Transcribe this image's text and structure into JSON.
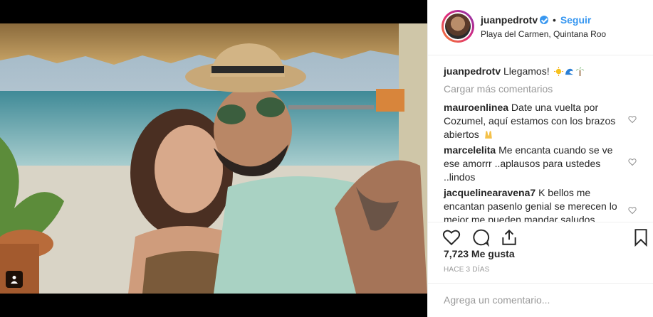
{
  "header": {
    "username": "juanpedrotv",
    "separator": "•",
    "follow_label": "Seguir",
    "location": "Playa del Carmen, Quintana Roo"
  },
  "caption": {
    "username": "juanpedrotv",
    "text": "Llegamos!",
    "emojis": [
      "sun-emoji",
      "wave-emoji",
      "palm-tree-emoji"
    ]
  },
  "load_more": "Cargar más comentarios",
  "comments": [
    {
      "username": "mauroenlinea",
      "text": "Date una vuelta por Cozumel, aquí estamos con los brazos abiertos",
      "emoji": "raised-hands-emoji"
    },
    {
      "username": "marcelelita",
      "text": "Me encanta cuando se ve ese amorrr ..aplausos para ustedes ..lindos"
    },
    {
      "username": "jacquelinearavena7",
      "text": "K bellos me encantan pasenlo genial se merecen lo mejor me pueden mandar saludos"
    }
  ],
  "likes": "7,723 Me gusta",
  "time_ago": "HACE 3 DÍAS",
  "add_comment_placeholder": "Agrega un comentario...",
  "colors": {
    "accent": "#3897f0",
    "text": "#262626",
    "muted": "#999999",
    "border": "#efefef"
  }
}
